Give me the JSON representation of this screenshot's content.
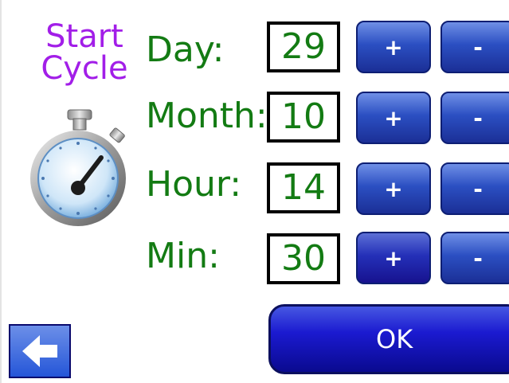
{
  "title": {
    "line1": "Start",
    "line2": "Cycle"
  },
  "icons": {
    "stopwatch": "stopwatch-icon",
    "back": "back-arrow-icon"
  },
  "colors": {
    "label_green": "#137b13",
    "title_purple": "#a21ee8",
    "button_blue": "#2b4fc2"
  },
  "fields": [
    {
      "label": "Day:",
      "value": "29",
      "plus": "+",
      "minus": "-"
    },
    {
      "label": "Month:",
      "value": "10",
      "plus": "+",
      "minus": "-"
    },
    {
      "label": "Hour:",
      "value": "14",
      "plus": "+",
      "minus": "-"
    },
    {
      "label": "Min:",
      "value": "30",
      "plus": "+",
      "minus": "-"
    }
  ],
  "ok_label": "OK"
}
